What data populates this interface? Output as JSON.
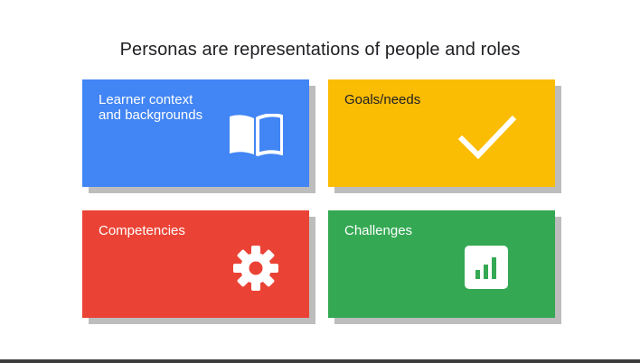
{
  "slide": {
    "title": "Personas are representations of people and roles"
  },
  "cards": [
    {
      "label": "Learner context\nand backgrounds",
      "color": "#4285F4",
      "icon": "open-book-icon"
    },
    {
      "label": "Goals/needs",
      "color": "#FBBC04",
      "icon": "checkmark-icon"
    },
    {
      "label": "Competencies",
      "color": "#EA4335",
      "icon": "gear-icon"
    },
    {
      "label": "Challenges",
      "color": "#34A853",
      "icon": "bar-chart-icon"
    }
  ]
}
